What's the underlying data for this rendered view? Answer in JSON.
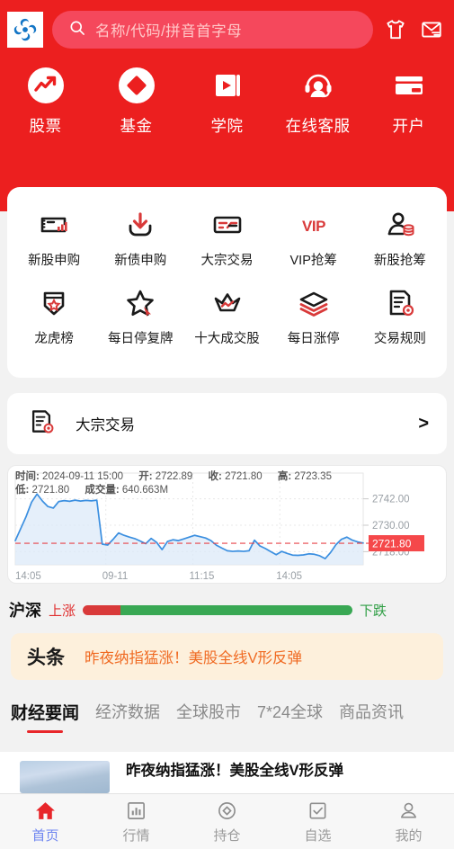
{
  "header": {
    "logo_icon": "pinwheel-logo-icon",
    "search": {
      "icon": "search-icon",
      "placeholder": "名称/代码/拼音首字母",
      "value": ""
    },
    "actions": [
      {
        "icon": "tshirt-icon",
        "name": "tshirt"
      },
      {
        "icon": "envelope-icon",
        "name": "messages"
      }
    ],
    "background_color": "#ec1f1f",
    "search_bg_color": "#f5485c"
  },
  "quick_nav": [
    {
      "label": "股票",
      "icon": "trend-chart-circle-icon"
    },
    {
      "label": "基金",
      "icon": "diamond-circle-icon"
    },
    {
      "label": "学院",
      "icon": "play-book-icon"
    },
    {
      "label": "在线客服",
      "icon": "headset-support-icon"
    },
    {
      "label": "开户",
      "icon": "bank-card-icon"
    }
  ],
  "grid": {
    "row1": [
      {
        "label": "新股申购",
        "icon": "ticket-bars-icon"
      },
      {
        "label": "新债申购",
        "icon": "download-arrow-icon"
      },
      {
        "label": "大宗交易",
        "icon": "exchange-card-icon"
      },
      {
        "label": "VIP抢筹",
        "icon": "vip-text-icon"
      },
      {
        "label": "新股抢筹",
        "icon": "person-coins-icon"
      }
    ],
    "row2": [
      {
        "label": "龙虎榜",
        "icon": "shield-star-icon"
      },
      {
        "label": "每日停复牌",
        "icon": "star-cursor-icon"
      },
      {
        "label": "十大成交股",
        "icon": "crown-trend-icon"
      },
      {
        "label": "每日涨停",
        "icon": "layers-icon"
      },
      {
        "label": "交易规则",
        "icon": "document-gear-icon"
      }
    ]
  },
  "block_trade": {
    "icon": "document-gear-icon",
    "title": "大宗交易",
    "arrow": ">"
  },
  "chart_data": {
    "type": "line",
    "title": "",
    "tooltip": {
      "time_label": "时间:",
      "time_value": "2024-09-11 15:00",
      "open_label": "开:",
      "open_value": "2722.89",
      "close_label": "收:",
      "close_value": "2721.80",
      "high_label": "高:",
      "high_value": "2723.35",
      "low_label": "低:",
      "low_value": "2721.80",
      "volume_label": "成交量:",
      "volume_value": "640.663M"
    },
    "xlabel": "",
    "ylabel": "",
    "x_ticks": [
      "14:05",
      "09-11",
      "11:15",
      "14:05"
    ],
    "y_ticks": [
      "2742.00",
      "2730.00",
      "2718.00"
    ],
    "ylim": [
      2712.0,
      2748.0
    ],
    "grid": true,
    "legend": "none",
    "last_price": "2721.80",
    "last_price_badge_color": "#f5484a",
    "reference_line_value": 2721.8,
    "line_color": "#3b8fe0",
    "area_color": "#dceaf8",
    "values": [
      2723.0,
      2728.5,
      2734.0,
      2740.5,
      2744.2,
      2741.0,
      2738.5,
      2737.8,
      2740.8,
      2741.2,
      2740.9,
      2741.4,
      2741.0,
      2741.3,
      2741.1,
      2741.4,
      2721.4,
      2721.0,
      2723.6,
      2726.5,
      2725.4,
      2724.6,
      2723.9,
      2722.8,
      2721.6,
      2724.0,
      2722.2,
      2718.9,
      2722.6,
      2723.4,
      2723.0,
      2723.8,
      2724.6,
      2725.4,
      2724.8,
      2724.2,
      2723.0,
      2720.9,
      2719.6,
      2718.4,
      2718.1,
      2718.3,
      2718.1,
      2718.4,
      2723.2,
      2720.6,
      2719.4,
      2718.0,
      2716.6,
      2718.1,
      2717.2,
      2716.4,
      2716.3,
      2716.5,
      2717.0,
      2716.8,
      2716.1,
      2714.8,
      2717.6,
      2721.2,
      2723.6,
      2724.6,
      2723.2,
      2722.4,
      2721.9
    ]
  },
  "updown": {
    "market_label": "沪深",
    "up_label": "上涨",
    "down_label": "下跌",
    "up_percent": 14,
    "down_percent": 86,
    "up_color": "#d93a3a",
    "down_color": "#39a854"
  },
  "headline": {
    "badge": "头条",
    "text": "昨夜纳指猛涨！美股全线V形反弹",
    "bg_color": "#fdf0dc",
    "text_color": "#f06a22"
  },
  "news_tabs": [
    {
      "label": "财经要闻",
      "active": true
    },
    {
      "label": "经济数据",
      "active": false
    },
    {
      "label": "全球股市",
      "active": false
    },
    {
      "label": "7*24全球",
      "active": false
    },
    {
      "label": "商品资讯",
      "active": false
    }
  ],
  "news_list": [
    {
      "title": "昨夜纳指猛涨！美股全线V形反弹",
      "thumb": "sky-photo-thumbnail"
    }
  ],
  "bottom_nav": [
    {
      "label": "首页",
      "icon": "home-icon",
      "active": true
    },
    {
      "label": "行情",
      "icon": "bar-chart-icon",
      "active": false
    },
    {
      "label": "持仓",
      "icon": "target-diamond-icon",
      "active": false
    },
    {
      "label": "自选",
      "icon": "checkbox-icon",
      "active": false
    },
    {
      "label": "我的",
      "icon": "user-icon",
      "active": false
    }
  ]
}
